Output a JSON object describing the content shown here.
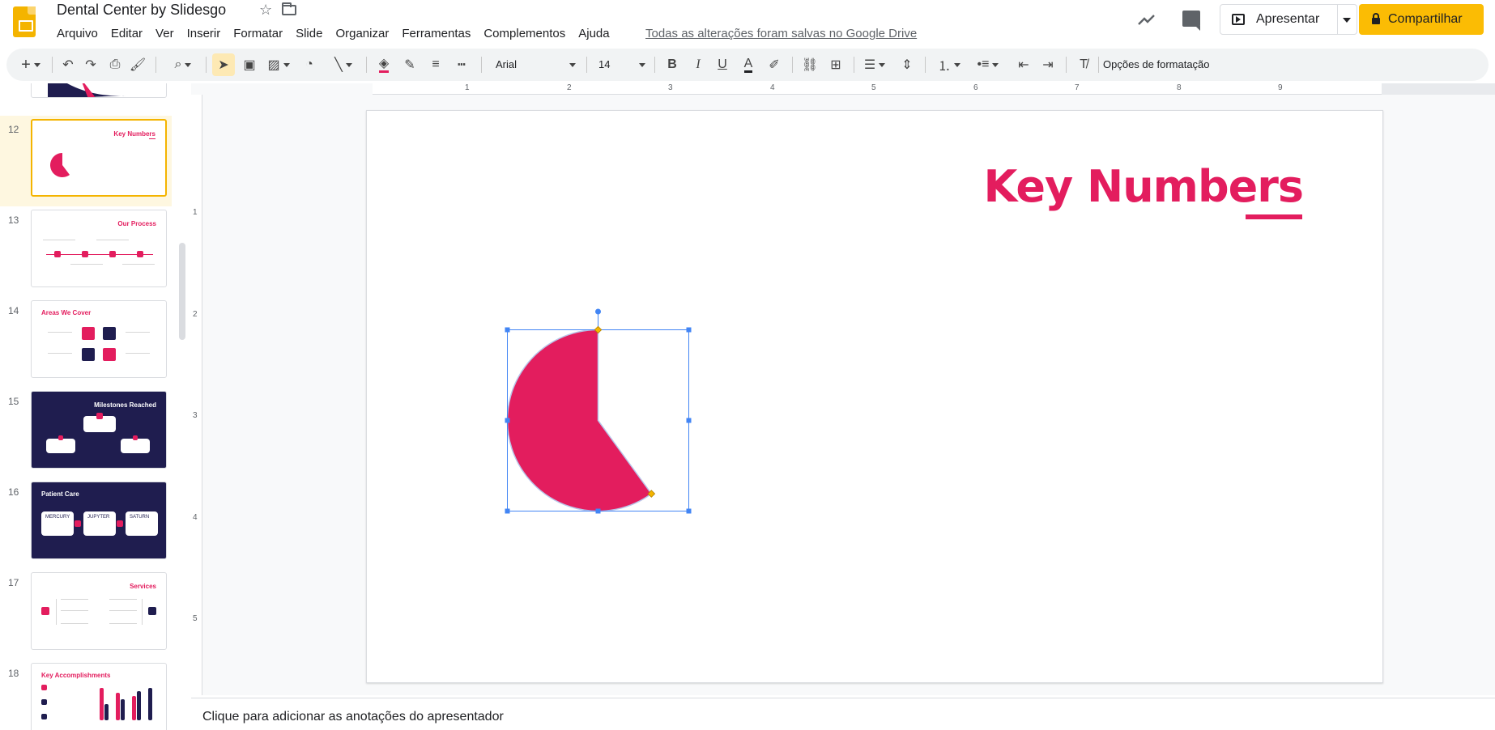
{
  "app": {
    "doc_title": "Dental Center by Slidesgo",
    "save_status": "Todas as alterações foram salvas no Google Drive",
    "accent_color": "#fbbc04"
  },
  "menu": [
    "Arquivo",
    "Editar",
    "Ver",
    "Inserir",
    "Formatar",
    "Slide",
    "Organizar",
    "Ferramentas",
    "Complementos",
    "Ajuda"
  ],
  "header_actions": {
    "present_label": "Apresentar",
    "share_label": "Compartilhar"
  },
  "toolbar": {
    "font_name": "Arial",
    "font_size": "14",
    "format_options": "Opções de formatação"
  },
  "filmstrip": {
    "slides": [
      {
        "num": "12",
        "title": "Key Numbers",
        "selected": true
      },
      {
        "num": "13",
        "title": "Our Process"
      },
      {
        "num": "14",
        "title": "Areas We Cover"
      },
      {
        "num": "15",
        "title": "Milestones Reached"
      },
      {
        "num": "16",
        "title": "Patient Care"
      },
      {
        "num": "17",
        "title": "Services"
      },
      {
        "num": "18",
        "title": "Key Accomplishments"
      }
    ],
    "thumb_texts": {
      "mercury": "MERCURY",
      "jupyter": "JUPYTER",
      "saturn": "SATURN"
    }
  },
  "ruler": {
    "h_labels": [
      "1",
      "2",
      "3",
      "4",
      "5",
      "6",
      "7",
      "8",
      "9"
    ],
    "v_labels": [
      "1",
      "2",
      "3",
      "4",
      "5"
    ]
  },
  "slide": {
    "title": "Key Numbers",
    "title_color": "#e31d5e",
    "pie_color": "#e31d5e",
    "pie_fraction": 0.6
  },
  "notes": {
    "placeholder": "Clique para adicionar as anotações do apresentador"
  }
}
